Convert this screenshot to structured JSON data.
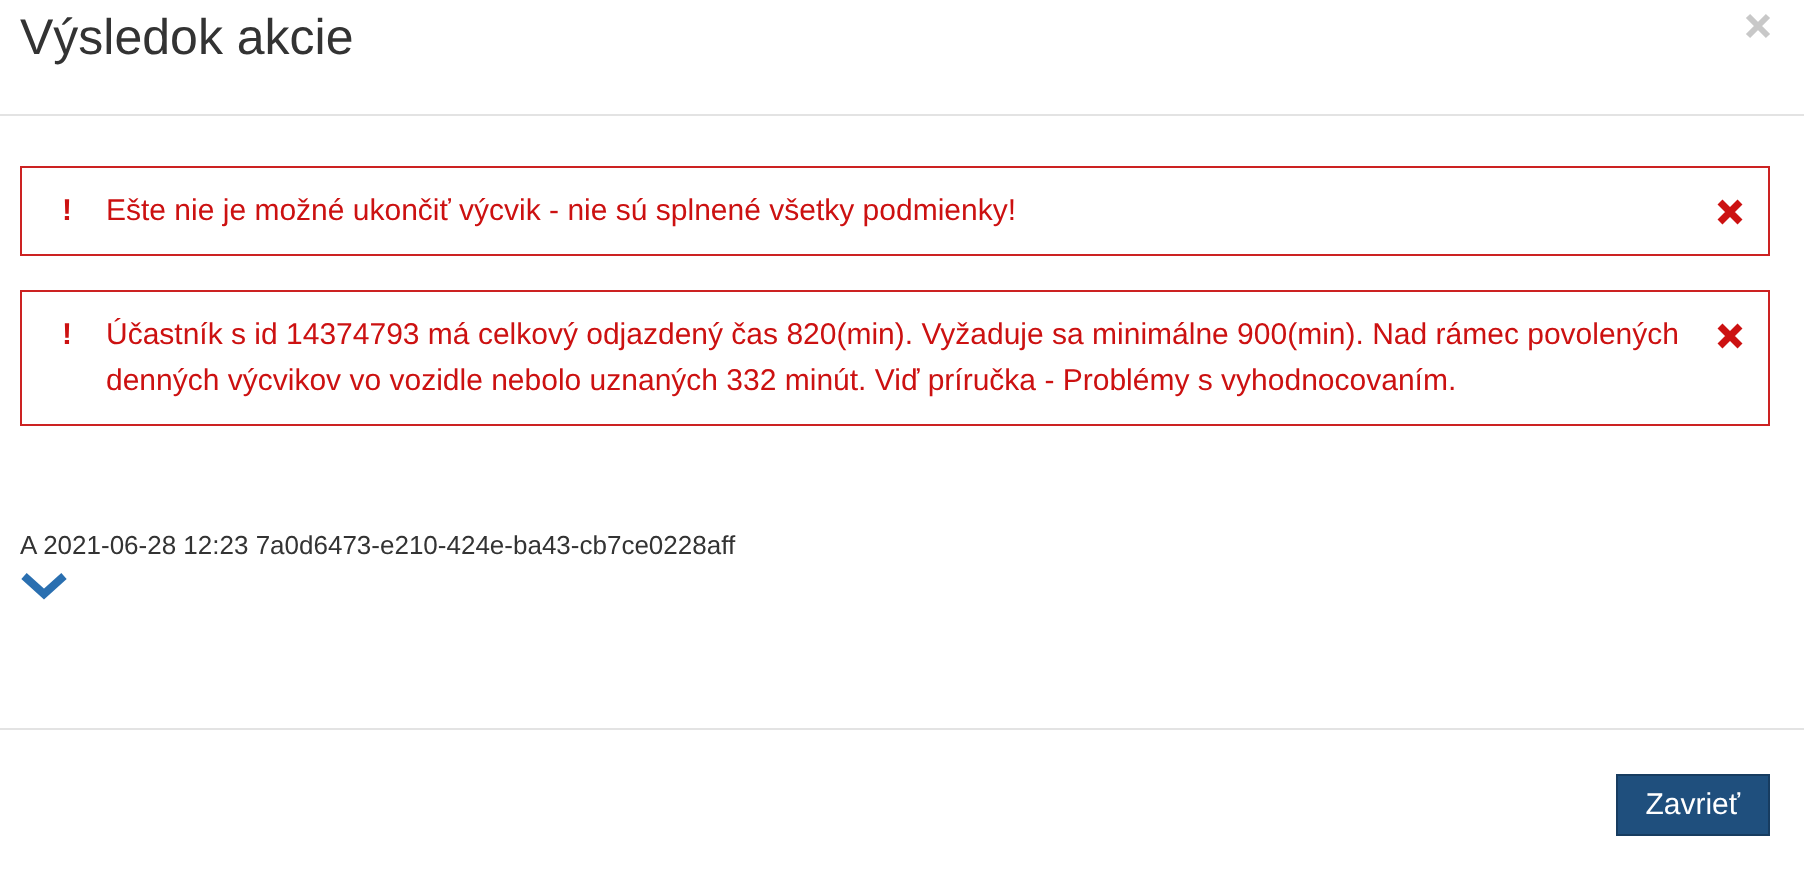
{
  "dialog": {
    "title": "Výsledok akcie"
  },
  "alerts": [
    {
      "mark": "!",
      "message": "Ešte nie je možné ukončiť výcvik - nie sú splnené všetky podmienky!"
    },
    {
      "mark": "!",
      "message": "Účastník s id 14374793 má celkový odjazdený čas 820(min). Vyžaduje sa minimálne 900(min). Nad rámec povolených denných výcvikov vo vozidle nebolo uznaných 332 minút. Viď príručka - Problémy s vyhodnocovaním."
    }
  ],
  "details": {
    "text": "A 2021-06-28 12:23 7a0d6473-e210-424e-ba43-cb7ce0228aff",
    "expanded": false
  },
  "buttons": [
    {
      "label": "Zavrieť"
    }
  ]
}
